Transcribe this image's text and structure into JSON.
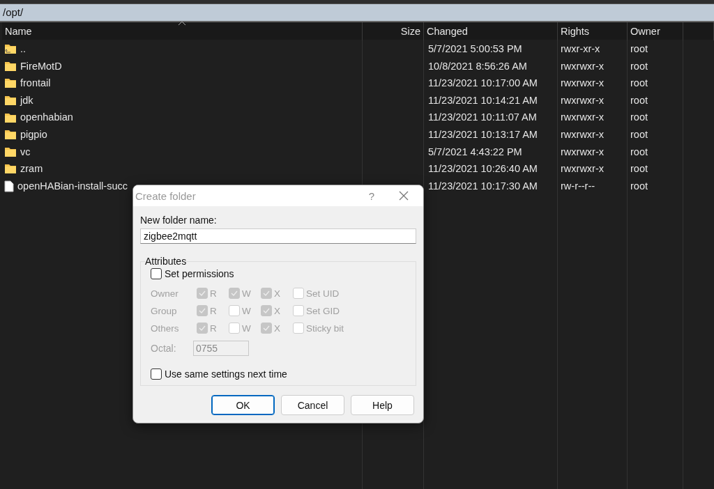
{
  "path": "/opt/",
  "columns": [
    {
      "label": "Name",
      "sorted": true
    },
    {
      "label": "Size",
      "sorted": false
    },
    {
      "label": "Changed",
      "sorted": false
    },
    {
      "label": "Rights",
      "sorted": false
    },
    {
      "label": "Owner",
      "sorted": false
    }
  ],
  "rows": [
    {
      "kind": "parent",
      "name": "..",
      "changed": "5/7/2021 5:00:53 PM",
      "rights": "rwxr-xr-x",
      "owner": "root"
    },
    {
      "kind": "folder",
      "name": "FireMotD",
      "changed": "10/8/2021 8:56:26 AM",
      "rights": "rwxrwxr-x",
      "owner": "root"
    },
    {
      "kind": "folder",
      "name": "frontail",
      "changed": "11/23/2021 10:17:00 AM",
      "rights": "rwxrwxr-x",
      "owner": "root"
    },
    {
      "kind": "folder",
      "name": "jdk",
      "changed": "11/23/2021 10:14:21 AM",
      "rights": "rwxrwxr-x",
      "owner": "root"
    },
    {
      "kind": "folder",
      "name": "openhabian",
      "changed": "11/23/2021 10:11:07 AM",
      "rights": "rwxrwxr-x",
      "owner": "root"
    },
    {
      "kind": "folder",
      "name": "pigpio",
      "changed": "11/23/2021 10:13:17 AM",
      "rights": "rwxrwxr-x",
      "owner": "root"
    },
    {
      "kind": "folder",
      "name": "vc",
      "changed": "5/7/2021 4:43:22 PM",
      "rights": "rwxrwxr-x",
      "owner": "root"
    },
    {
      "kind": "folder",
      "name": "zram",
      "changed": "11/23/2021 10:26:40 AM",
      "rights": "rwxrwxr-x",
      "owner": "root"
    },
    {
      "kind": "file",
      "name": "openHABian-install-succ",
      "changed": "11/23/2021 10:17:30 AM",
      "rights": "rw-r--r--",
      "owner": "root"
    }
  ],
  "dialog": {
    "title": "Create folder",
    "help_glyph": "?",
    "name_label": "New folder name:",
    "name_value": "zigbee2mqtt",
    "attributes_legend": "Attributes",
    "set_permissions": {
      "label": "Set permissions",
      "checked": false
    },
    "permissions": {
      "disabled": true,
      "rows": [
        {
          "label": "Owner",
          "bits": [
            {
              "letter": "R",
              "checked": true
            },
            {
              "letter": "W",
              "checked": true
            },
            {
              "letter": "X",
              "checked": true
            }
          ],
          "special": {
            "label": "Set UID",
            "checked": false
          }
        },
        {
          "label": "Group",
          "bits": [
            {
              "letter": "R",
              "checked": true
            },
            {
              "letter": "W",
              "checked": false
            },
            {
              "letter": "X",
              "checked": true
            }
          ],
          "special": {
            "label": "Set GID",
            "checked": false
          }
        },
        {
          "label": "Others",
          "bits": [
            {
              "letter": "R",
              "checked": true
            },
            {
              "letter": "W",
              "checked": false
            },
            {
              "letter": "X",
              "checked": true
            }
          ],
          "special": {
            "label": "Sticky bit",
            "checked": false
          }
        }
      ],
      "octal_label": "Octal:",
      "octal_value": "0755"
    },
    "same_settings": {
      "label": "Use same settings next time",
      "checked": false
    },
    "buttons": [
      {
        "label": "OK",
        "default": true
      },
      {
        "label": "Cancel",
        "default": false
      },
      {
        "label": "Help",
        "default": false
      }
    ]
  }
}
